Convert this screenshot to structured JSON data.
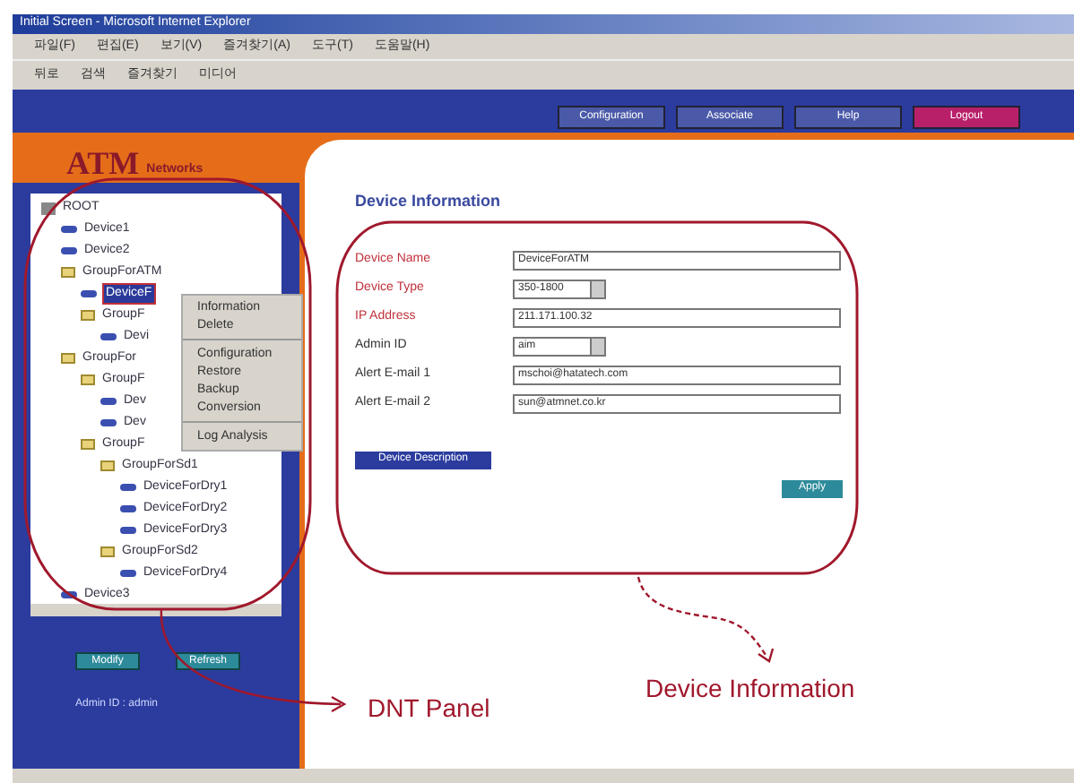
{
  "window": {
    "title": "Initial Screen - Microsoft Internet Explorer"
  },
  "menu": [
    "파일(F)",
    "편집(E)",
    "보기(V)",
    "즐겨찾기(A)",
    "도구(T)",
    "도움말(H)"
  ],
  "toolbar": [
    "뒤로",
    "검색",
    "즐겨찾기",
    "미디어"
  ],
  "nav_buttons": [
    {
      "label": "Configuration",
      "kind": "normal"
    },
    {
      "label": "Associate",
      "kind": "normal"
    },
    {
      "label": "Help",
      "kind": "normal"
    },
    {
      "label": "Logout",
      "kind": "logout"
    }
  ],
  "logo": {
    "mark": "ATM",
    "word": "Networks"
  },
  "tree": [
    {
      "label": "ROOT",
      "kind": "root",
      "selected": false,
      "children": [
        {
          "label": "Device1",
          "kind": "device",
          "selected": false
        },
        {
          "label": "Device2",
          "kind": "device",
          "selected": false
        },
        {
          "label": "GroupForATM",
          "kind": "group",
          "selected": false,
          "children": [
            {
              "label": "DeviceF",
              "kind": "device",
              "selected": true
            },
            {
              "label": "GroupF",
              "kind": "group",
              "selected": false,
              "children": [
                {
                  "label": "Devi",
                  "kind": "device",
                  "selected": false
                }
              ]
            }
          ]
        },
        {
          "label": "GroupFor",
          "kind": "group",
          "selected": false,
          "children": [
            {
              "label": "GroupF",
              "kind": "group",
              "selected": false,
              "children": [
                {
                  "label": "Dev",
                  "kind": "device",
                  "selected": false
                },
                {
                  "label": "Dev",
                  "kind": "device",
                  "selected": false
                }
              ]
            },
            {
              "label": "GroupF",
              "kind": "group",
              "selected": false,
              "children": [
                {
                  "label": "GroupForSd1",
                  "kind": "group",
                  "selected": false,
                  "children": [
                    {
                      "label": "DeviceForDry1",
                      "kind": "device",
                      "selected": false
                    },
                    {
                      "label": "DeviceForDry2",
                      "kind": "device",
                      "selected": false
                    },
                    {
                      "label": "DeviceForDry3",
                      "kind": "device",
                      "selected": false
                    }
                  ]
                },
                {
                  "label": "GroupForSd2",
                  "kind": "group",
                  "selected": false,
                  "children": [
                    {
                      "label": "DeviceForDry4",
                      "kind": "device",
                      "selected": false
                    }
                  ]
                }
              ]
            }
          ]
        },
        {
          "label": "Device3",
          "kind": "device",
          "selected": false
        }
      ]
    }
  ],
  "context_menu": [
    [
      "Information",
      "Delete"
    ],
    [
      "Configuration",
      "Restore",
      "Backup",
      "Conversion"
    ],
    [
      "Log Analysis"
    ]
  ],
  "panel_buttons": [
    "Modify",
    "Refresh"
  ],
  "admin_label": "Admin ID : admin",
  "form": {
    "title": "Device Information",
    "fields": [
      {
        "label": "Device Name",
        "kind": "text",
        "required": true,
        "value": "DeviceForATM"
      },
      {
        "label": "Device Type",
        "kind": "select",
        "required": true,
        "value": "350-1800"
      },
      {
        "label": "IP Address",
        "kind": "text",
        "required": true,
        "value": "211.171.100.32"
      },
      {
        "label": "Admin ID",
        "kind": "select",
        "required": false,
        "value": "aim"
      },
      {
        "label": "Alert E-mail 1",
        "kind": "text",
        "required": false,
        "value": "mschoi@hatatech.com"
      },
      {
        "label": "Alert E-mail 2",
        "kind": "text",
        "required": false,
        "value": "sun@atmnet.co.kr"
      }
    ],
    "description_button": "Device Description",
    "apply_button": "Apply"
  },
  "annotations": [
    "DNT Panel",
    "Device Information"
  ]
}
